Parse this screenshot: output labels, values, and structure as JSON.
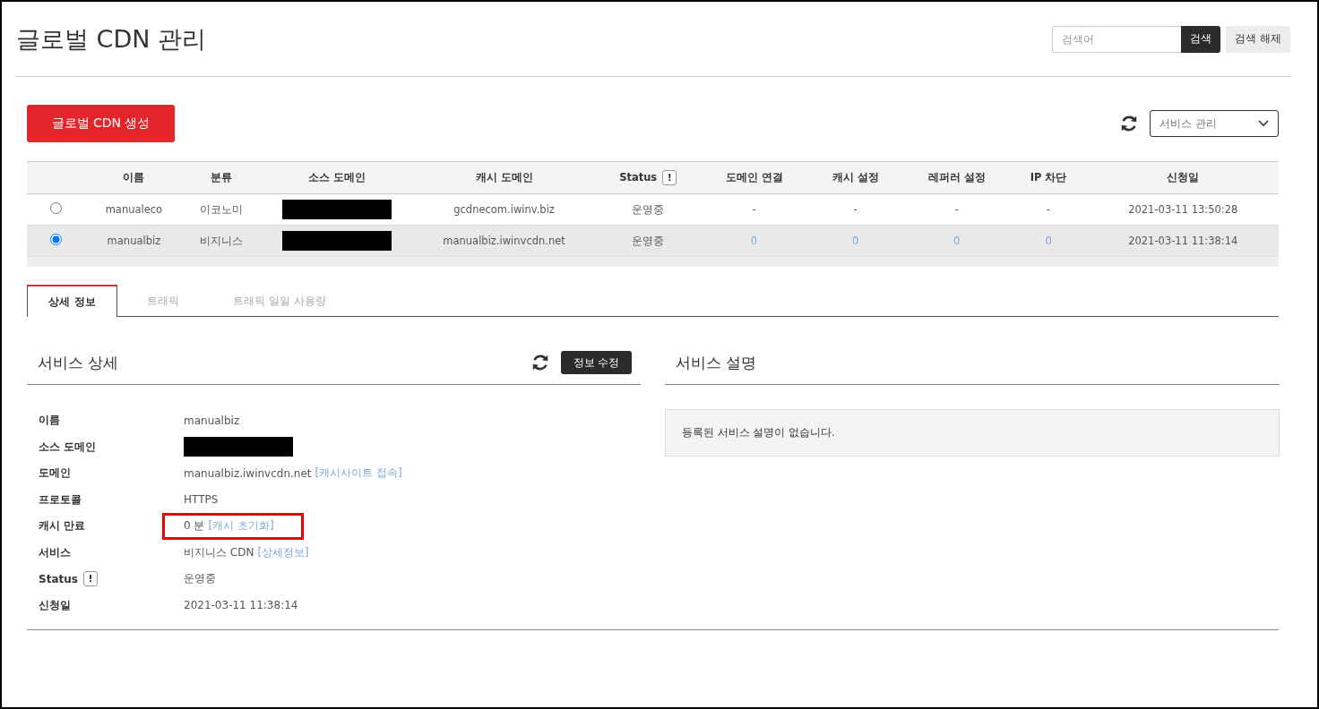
{
  "page_title": "글로벌 CDN 관리",
  "search": {
    "placeholder": "검색어",
    "button": "검색",
    "clear_button": "검색 해제"
  },
  "create_button": "글로벌 CDN 생성",
  "service_select": {
    "value": "서비스 관리"
  },
  "table": {
    "columns": [
      {
        "kind": "select"
      },
      {
        "label": "이름"
      },
      {
        "label": "분류"
      },
      {
        "label": "소스 도메인"
      },
      {
        "label": "캐시 도메인"
      },
      {
        "label": "Status",
        "mark": "!"
      },
      {
        "label": "도메인 연결"
      },
      {
        "label": "캐시 설정"
      },
      {
        "label": "레퍼러 설정"
      },
      {
        "label": "IP 차단"
      },
      {
        "label": "신청일"
      }
    ],
    "rows": [
      {
        "selected": false,
        "cells": [
          {
            "kind": "radio"
          },
          {
            "kind": "text",
            "text": "manualeco"
          },
          {
            "kind": "text",
            "text": "이코노미"
          },
          {
            "kind": "redacted"
          },
          {
            "kind": "text",
            "text": "gcdnecom.iwinv.biz"
          },
          {
            "kind": "text",
            "text": "운영중"
          },
          {
            "kind": "text",
            "text": "-"
          },
          {
            "kind": "text",
            "text": "-"
          },
          {
            "kind": "text",
            "text": "-"
          },
          {
            "kind": "text",
            "text": "-"
          },
          {
            "kind": "text",
            "text": "2021-03-11 13:50:28"
          }
        ]
      },
      {
        "selected": true,
        "cells": [
          {
            "kind": "radio"
          },
          {
            "kind": "text",
            "text": "manualbiz"
          },
          {
            "kind": "text",
            "text": "비지니스"
          },
          {
            "kind": "redacted"
          },
          {
            "kind": "text",
            "text": "manualbiz.iwinvcdn.net"
          },
          {
            "kind": "text",
            "text": "운영중"
          },
          {
            "kind": "link",
            "text": "0"
          },
          {
            "kind": "link",
            "text": "0"
          },
          {
            "kind": "link",
            "text": "0"
          },
          {
            "kind": "link",
            "text": "0"
          },
          {
            "kind": "text",
            "text": "2021-03-11 11:38:14"
          }
        ]
      }
    ]
  },
  "tabs": [
    {
      "label": "상세 정보",
      "selected": true
    },
    {
      "label": "트래픽",
      "selected": false
    },
    {
      "label": "트래픽 일일 사용량",
      "selected": false
    }
  ],
  "service_detail": {
    "title": "서비스 상세",
    "edit_button": "정보 수정",
    "rows": [
      {
        "label": "이름",
        "value": "manualbiz",
        "highlighted": false
      },
      {
        "label": "소스 도메인",
        "redacted": true,
        "highlighted": false
      },
      {
        "label": "도메인",
        "value": "manualbiz.iwinvcdn.net",
        "link": "[캐시사이트 접속]",
        "highlighted": false
      },
      {
        "label": "프로토콜",
        "value": "HTTPS",
        "highlighted": false
      },
      {
        "label": "캐시 만료",
        "value": "0 분",
        "link": "[캐시 초기화]",
        "highlighted": true
      },
      {
        "label": "서비스",
        "value": "비지니스 CDN",
        "link": "[상세정보]",
        "highlighted": false
      },
      {
        "label": "Status",
        "mark": "!",
        "value": "운영중",
        "highlighted": false
      },
      {
        "label": "신청일",
        "value": "2021-03-11 11:38:14",
        "highlighted": false
      }
    ]
  },
  "service_description": {
    "title": "서비스 설명",
    "text": "등록된 서비스 설명이 없습니다."
  }
}
